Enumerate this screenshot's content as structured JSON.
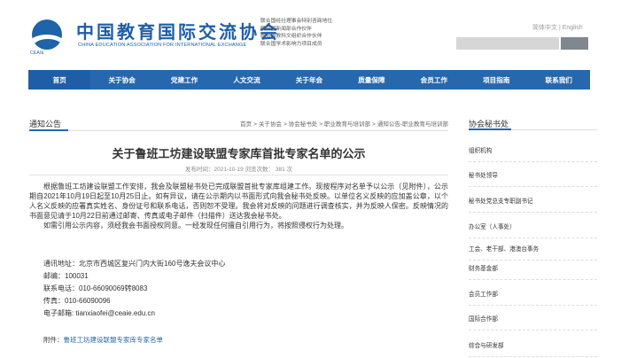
{
  "colors": {
    "brand": "#1f5ea6",
    "nav_bg": "#2667ad",
    "search_btn": "#7f8790"
  },
  "header": {
    "logo_caption": "CEAIE",
    "logo_cn": "中国教育国际交流协会",
    "logo_en": "CHINA EDUCATION ASSOCIATION FOR INTERNATIONAL EXCHANGE",
    "memberships": [
      "联合国经社理事会特别咨商地位",
      "联合国新闻部合作伙伴",
      "联合国教科文组织合作伙伴",
      "联合国学术影响力项目成员"
    ],
    "lang_cn": "简体中文",
    "lang_sep": " | ",
    "lang_en": "English",
    "search_value": "",
    "search_placeholder": "",
    "search_button_label": ""
  },
  "nav": {
    "items": [
      {
        "label": "首页"
      },
      {
        "label": "关于协会"
      },
      {
        "label": "党建工作"
      },
      {
        "label": "人文交流"
      },
      {
        "label": "关于年会"
      },
      {
        "label": "质量保障"
      },
      {
        "label": "会员工作"
      },
      {
        "label": "项目指南"
      },
      {
        "label": "联系我们"
      }
    ]
  },
  "main": {
    "section_title": "通知公告",
    "breadcrumbs": [
      "首页",
      "关于协会",
      "协会秘书处",
      "职业教育与培训部",
      "通知公告-职业教育与培训部"
    ],
    "crumb_sep": ">",
    "article_title": "关于鲁班工坊建设联盟专家库首批专家名单的公示",
    "meta": "发布时间：2021-10-19  浏览次数： 381 次",
    "paragraphs": [
      "根据鲁班工坊建设联盟工作安排，我会及联盟秘书处已完成联盟首批专家库组建工作。现按程序对名单予以公示（见附件），公示期自2021年10月19日起至10月25日止。如有异议，请在公示期内以书面形式向我会秘书处反映。以单位名义反映的应加盖公章，以个人名义反映的应署真实姓名、身份证号和联系电话，否则恕不受理。我会将对反映的问题进行调查核实，并为反映人保密。反映情况的书面意见请于10月22日前通过邮寄、传真或电子邮件（扫描件）送达我会秘书处。",
      "如需引用公示内容，须经我会书面授权同意。一经发现任何擅自引用行为，将按照侵权行为处理。"
    ],
    "contact": [
      "通讯地址：北京市西城区复兴门内大街160号逸夫会议中心",
      "邮编：100031",
      "联系电话：010-66090069转8083",
      "传真：010-66090096",
      "电子邮箱: tianxiaofei@ceaie.edu.cn"
    ],
    "attachment_label": "附件：",
    "attachment_link": "鲁班工坊建设联盟专家库专家名单"
  },
  "sidebar": {
    "title": "协会秘书处",
    "items": [
      {
        "label": "组织机构"
      },
      {
        "label": "秘书处领导"
      },
      {
        "label": "秘书处党总支专职副书记"
      },
      {
        "label": "办公室（人事处）"
      },
      {
        "label": "工会、老干部、港澳台事务"
      },
      {
        "label": "财务基金部"
      },
      {
        "label": "会员工作部"
      },
      {
        "label": "国际合作部"
      },
      {
        "label": "综合与研发部"
      }
    ]
  }
}
